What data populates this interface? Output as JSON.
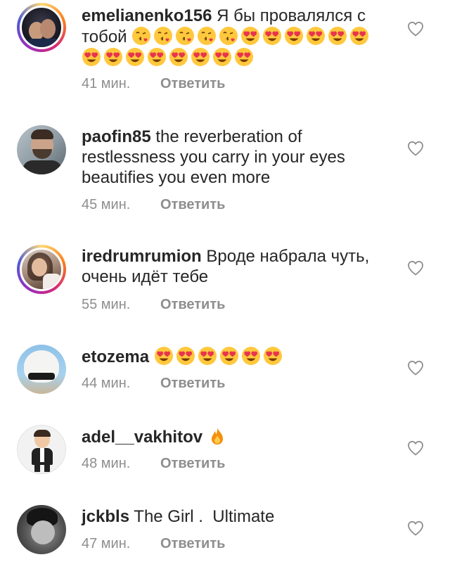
{
  "comments": [
    {
      "username": "emelianenko156",
      "text": "Я бы провалялся с тобой",
      "time": "41 мин.",
      "reply": "Ответить",
      "avatar": "avatar-man-dark"
    },
    {
      "username": "paofin85",
      "text": "the reverberation of restlessness you carry in your eyes beautifies you even more",
      "time": "45 мин.",
      "reply": "Ответить",
      "avatar": "avatar-man-beard"
    },
    {
      "username": "iredrumrumion",
      "text": "Вроде набрала чуть, очень идёт тебе",
      "time": "55 мин.",
      "reply": "Ответить",
      "avatar": "avatar-woman-mirror"
    },
    {
      "username": "etozema",
      "text": "",
      "time": "44 мин.",
      "reply": "Ответить",
      "avatar": "avatar-white-hair"
    },
    {
      "username": "adel__vakhitov",
      "text": "",
      "time": "48 мин.",
      "reply": "Ответить",
      "avatar": "avatar-cartoon"
    },
    {
      "username": "jckbls",
      "text": "The Girl .  Ultimate",
      "time": "47 мин.",
      "reply": "Ответить",
      "avatar": "avatar-bw-face"
    }
  ],
  "icons": {
    "like": "heart-outline-icon",
    "kiss": "kissing-face-emoji",
    "love": "heart-eyes-emoji",
    "fire": "fire-emoji"
  },
  "colors": {
    "username": "#262626",
    "meta": "#8e8e8e",
    "emoji_face": "#FFC83D"
  }
}
